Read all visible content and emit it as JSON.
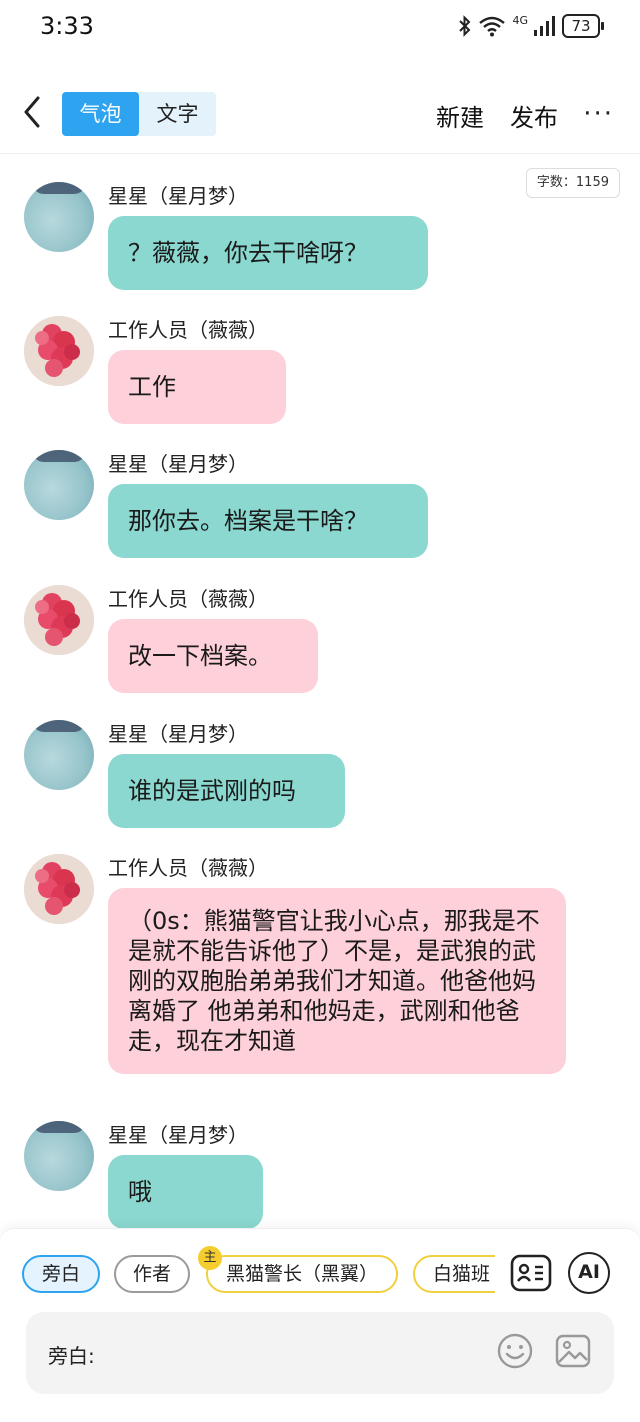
{
  "status_bar": {
    "time": "3:33",
    "network": "4G",
    "battery": "73"
  },
  "header": {
    "tabs": [
      {
        "label": "气泡",
        "active": true
      },
      {
        "label": "文字",
        "active": false
      }
    ],
    "new_label": "新建",
    "publish_label": "发布",
    "more_label": "···"
  },
  "word_count": "字数：1159",
  "messages": [
    {
      "sender": "星星（星月梦）",
      "text": "？薇薇，你去干啥呀？",
      "avatar": "star-avatar",
      "bubble_color": "#8ad8cf"
    },
    {
      "sender": "工作人员（薇薇）",
      "text": "工作",
      "avatar": "flower-avatar",
      "bubble_color": "#fdd0da"
    },
    {
      "sender": "星星（星月梦）",
      "text": "那你去。档案是干啥？",
      "avatar": "star-avatar",
      "bubble_color": "#8ad8cf"
    },
    {
      "sender": "工作人员（薇薇）",
      "text": "改一下档案。",
      "avatar": "flower-avatar",
      "bubble_color": "#fdd0da"
    },
    {
      "sender": "星星（星月梦）",
      "text": "谁的是武刚的吗",
      "avatar": "star-avatar",
      "bubble_color": "#8ad8cf"
    },
    {
      "sender": "工作人员（薇薇）",
      "text": "（0s：熊猫警官让我小心点，那我是不是就不能告诉他了）不是，是武狼的武刚的双胞胎弟弟我们才知道。他爸他妈离婚了 他弟弟和他妈走，武刚和他爸走，现在才知道",
      "avatar": "flower-avatar",
      "bubble_color": "#fdd0da"
    },
    {
      "sender": "星星（星月梦）",
      "text": "哦",
      "avatar": "star-avatar",
      "bubble_color": "#8ad8cf"
    }
  ],
  "role_chips": [
    {
      "label": "旁白",
      "selected": true
    },
    {
      "label": "作者",
      "selected": false
    },
    {
      "label": "黑猫警长（黑翼）",
      "selected": false,
      "main": true
    },
    {
      "label": "白猫班",
      "selected": false
    }
  ],
  "main_badge": "主",
  "input": {
    "label": "旁白:",
    "value": "",
    "placeholder": ""
  },
  "icons": {
    "role_card": "role-card-icon",
    "ai": "AI",
    "emoji": "emoji-icon",
    "image": "image-icon"
  }
}
